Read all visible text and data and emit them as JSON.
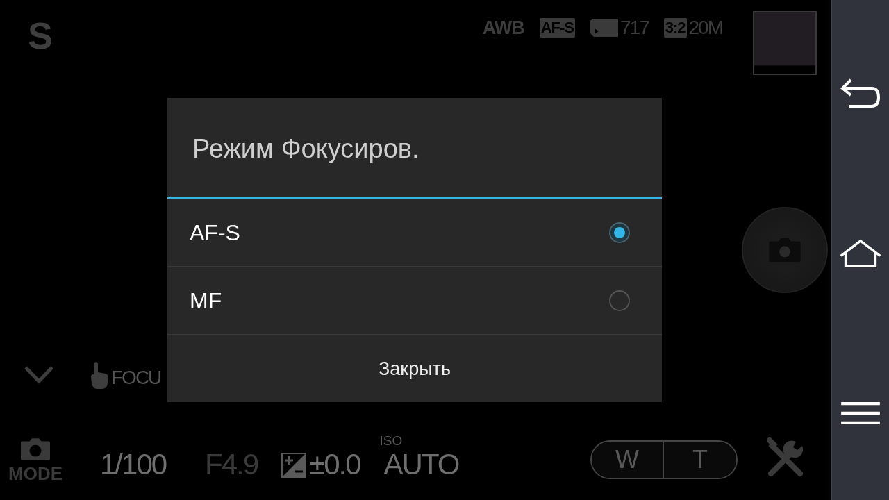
{
  "mode_letter": "S",
  "status": [
    {
      "kind": "text",
      "text": "AWB"
    },
    {
      "kind": "badge",
      "text": "AF-S"
    },
    {
      "kind": "card",
      "text": "717"
    },
    {
      "kind": "badge",
      "text": "3:2",
      "suffix": "20M"
    }
  ],
  "touch_focus": "FOCU",
  "mode_button": {
    "label": "MODE"
  },
  "shutter_speed": "1/100",
  "aperture": "F4.9",
  "exposure": "±0.0",
  "iso": {
    "label": "ISO",
    "value": "AUTO"
  },
  "zoom": [
    "W",
    "T"
  ],
  "dialog": {
    "title": "Режим Фокусиров.",
    "options": [
      {
        "label": "AF-S",
        "selected": true
      },
      {
        "label": "MF",
        "selected": false
      }
    ],
    "close": "Закрыть"
  }
}
